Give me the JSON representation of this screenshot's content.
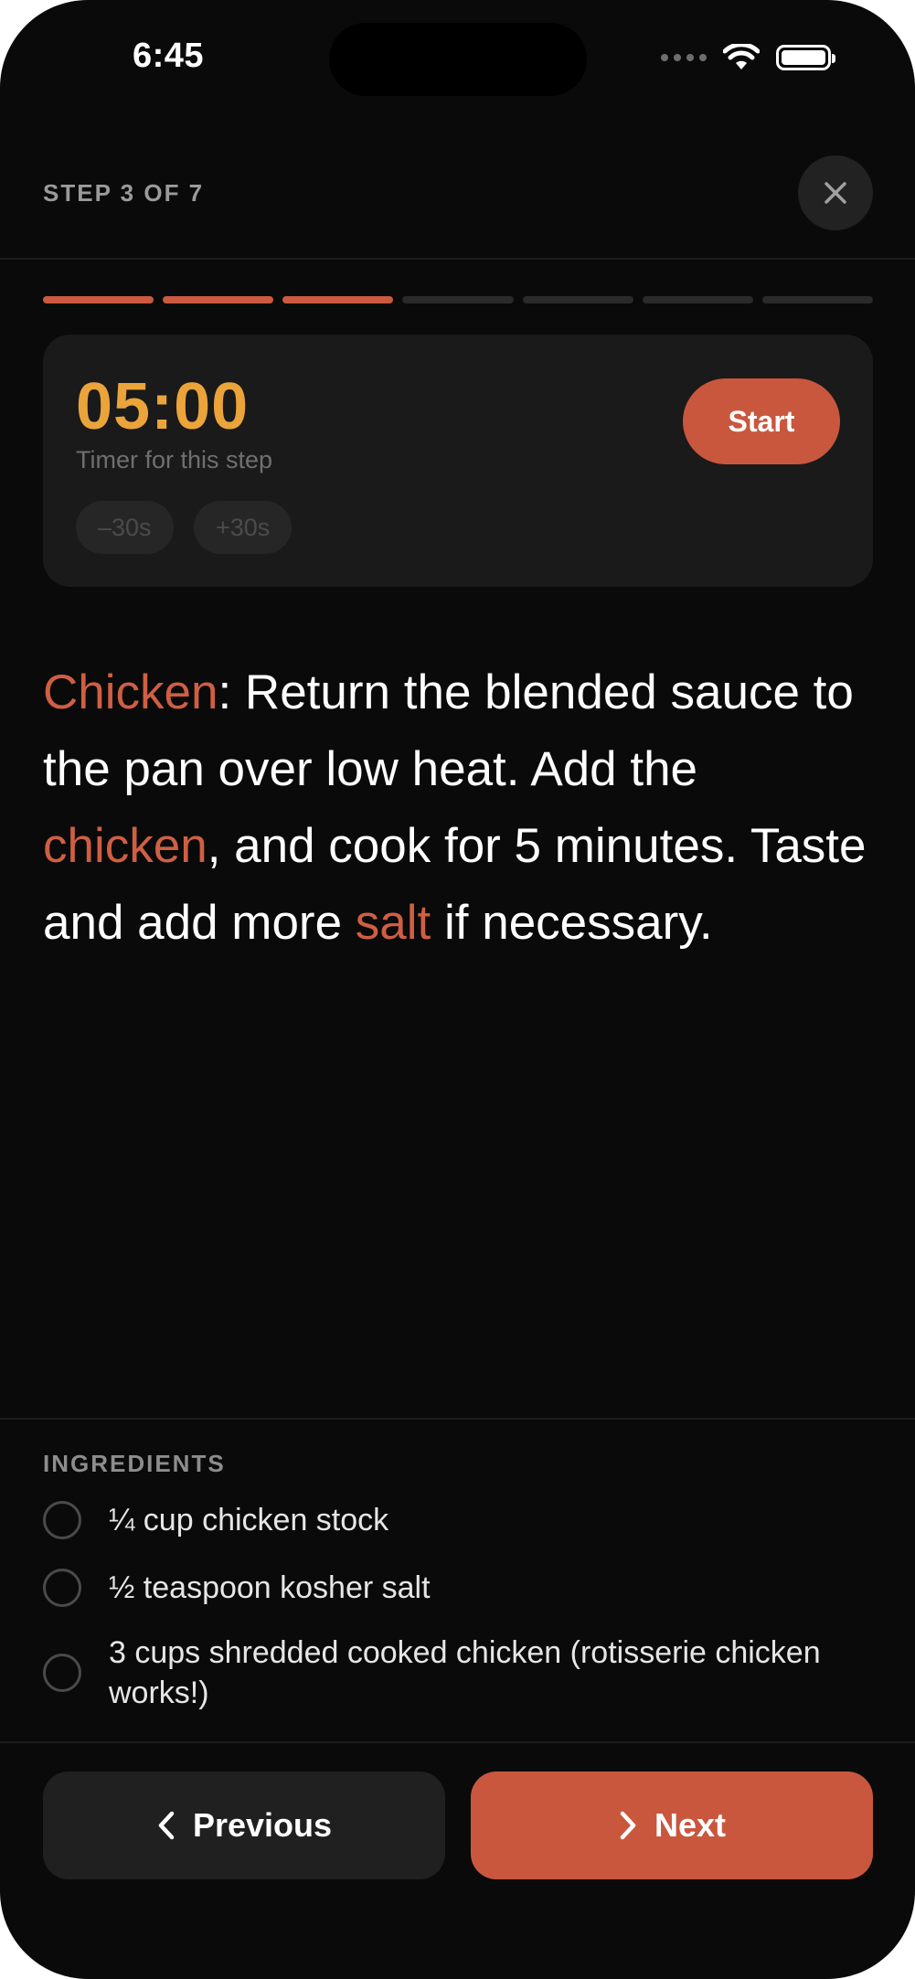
{
  "status_bar": {
    "time": "6:45",
    "icons": [
      "cellular-dots-icon",
      "wifi-icon",
      "battery-icon"
    ]
  },
  "header": {
    "step_label": "STEP 3 OF 7",
    "close_icon": "close-icon"
  },
  "progress": {
    "current_step": 3,
    "total_steps": 7
  },
  "timer": {
    "value": "05:00",
    "caption": "Timer for this step",
    "minus_label": "–30s",
    "plus_label": "+30s",
    "start_label": "Start"
  },
  "instruction": {
    "part1": "Chicken",
    "part2": ": Return the blended sauce to the pan over low heat. Add the ",
    "part3": "chicken",
    "part4": ", and cook for 5 minutes. Taste and add more ",
    "part5": "salt",
    "part6": " if necessary."
  },
  "ingredients": {
    "title": "INGREDIENTS",
    "items": [
      {
        "text": "¼ cup chicken stock"
      },
      {
        "text": "½ teaspoon kosher salt"
      },
      {
        "text": "3 cups shredded cooked chicken (rotisserie chicken works!)"
      }
    ]
  },
  "navigation": {
    "previous_label": "Previous",
    "next_label": "Next"
  },
  "colors": {
    "accent": "#c9573e",
    "timer": "#eaa43a",
    "background": "#0a0a0a",
    "card": "#1a1a1a"
  }
}
